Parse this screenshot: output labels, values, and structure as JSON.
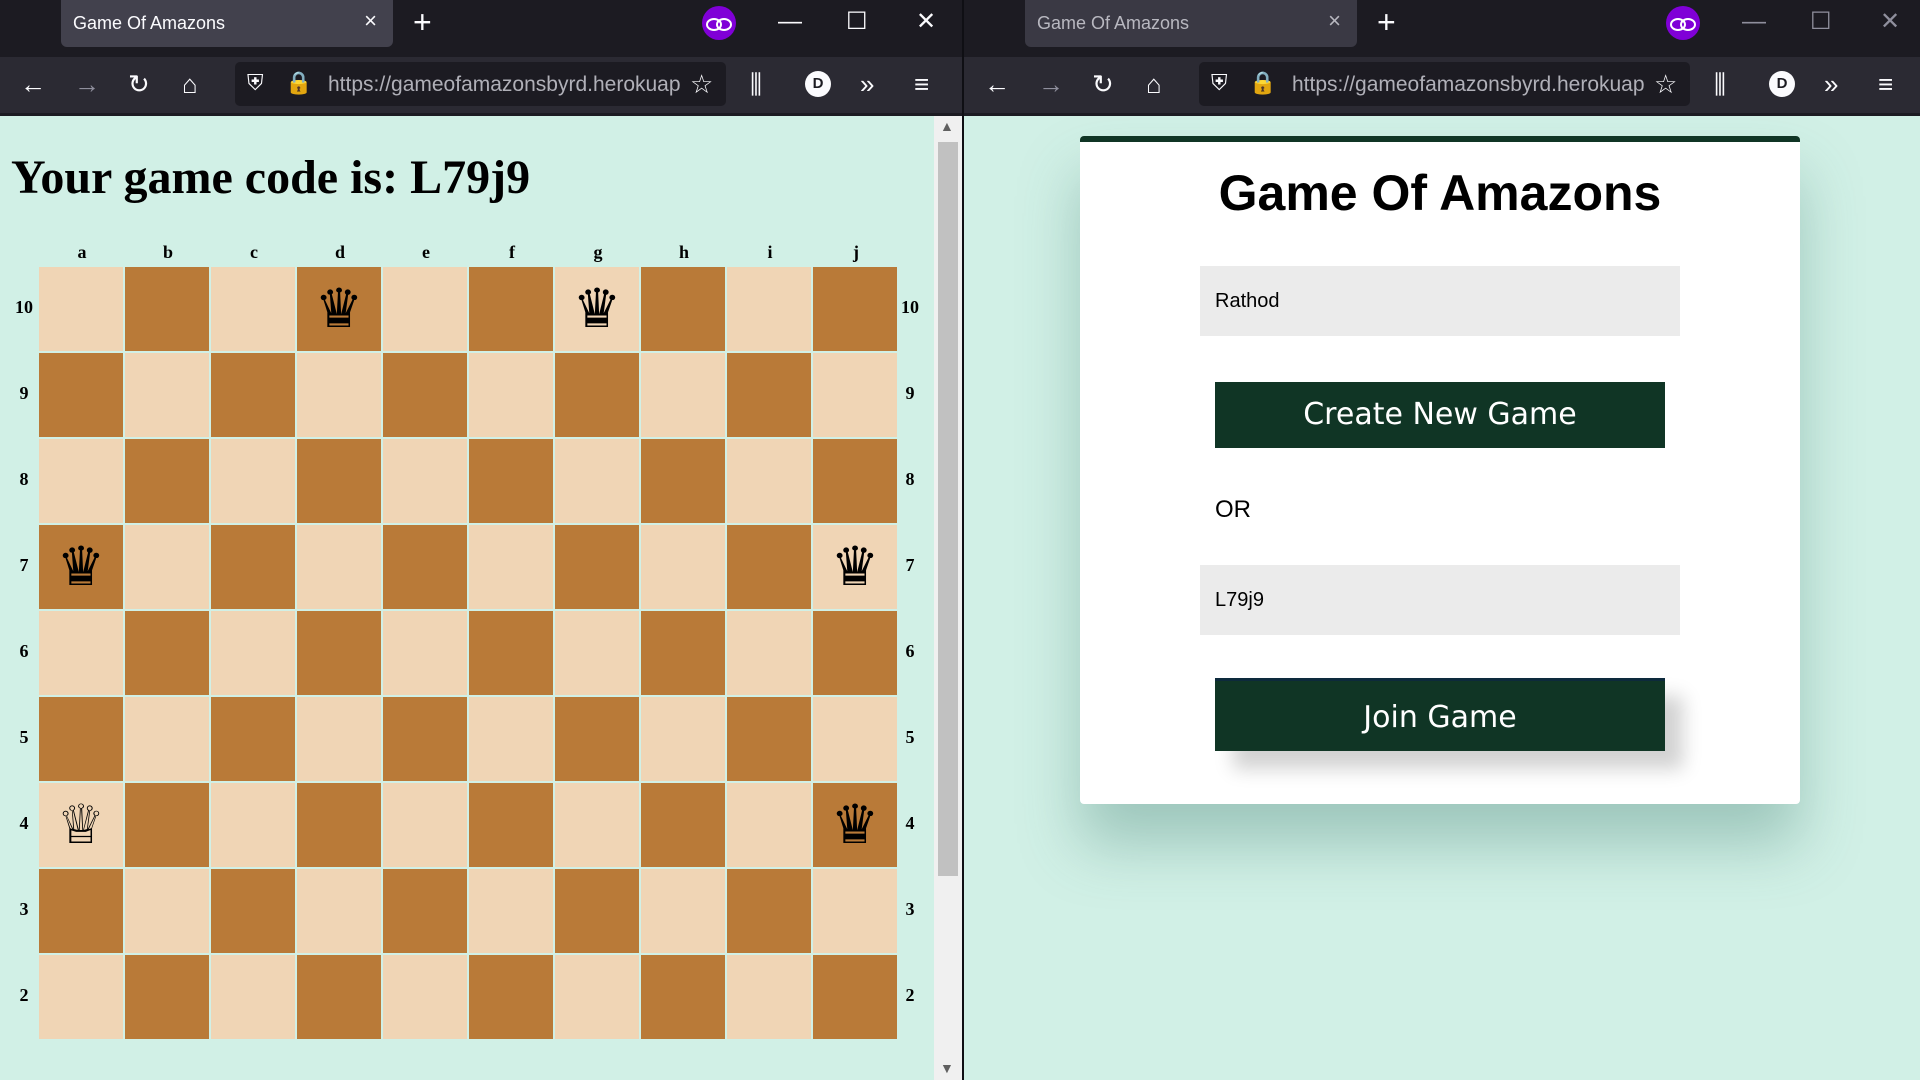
{
  "left_window": {
    "tab": {
      "title": "Game Of Amazons"
    },
    "url": "https://gameofamazonsbyrd.herokuap",
    "account_initial": "D",
    "page": {
      "heading": "Your game code is: L79j9",
      "columns": [
        "a",
        "b",
        "c",
        "d",
        "e",
        "f",
        "g",
        "h",
        "i",
        "j"
      ],
      "rows": [
        "10",
        "9",
        "8",
        "7",
        "6",
        "5",
        "4",
        "3",
        "2"
      ],
      "pieces": [
        {
          "square": "d10",
          "glyph": "♛",
          "color": "black"
        },
        {
          "square": "g10",
          "glyph": "♛",
          "color": "black"
        },
        {
          "square": "a7",
          "glyph": "♛",
          "color": "black"
        },
        {
          "square": "j7",
          "glyph": "♛",
          "color": "black"
        },
        {
          "square": "a4",
          "glyph": "♕",
          "color": "white"
        },
        {
          "square": "j4",
          "glyph": "♛",
          "color": "black"
        }
      ],
      "light_square_color": "#f0d5b5",
      "dark_square_color": "#b97a38"
    }
  },
  "right_window": {
    "tab": {
      "title": "Game Of Amazons"
    },
    "url": "https://gameofamazonsbyrd.herokuap",
    "account_initial": "D",
    "page": {
      "title": "Game Of Amazons",
      "name_value": "Rathod",
      "create_label": "Create New Game",
      "or_label": "OR",
      "code_value": "L79j9",
      "join_label": "Join Game"
    }
  },
  "icons": {
    "tab_close": "×",
    "new_tab": "+",
    "minimize": "—",
    "maximize": "☐",
    "close": "✕",
    "back": "←",
    "forward": "→",
    "reload": "↻",
    "home": "⌂",
    "shield": "⛨",
    "lock": "🔒",
    "bookmark_star": "☆",
    "library": "⫼",
    "overflow": "»",
    "menu": "≡",
    "scroll_up": "▲",
    "scroll_down": "▼"
  },
  "colors": {
    "page_bg": "#d1f0e6",
    "brand_dark_green": "#103525",
    "private_mask": "#8000d7"
  }
}
